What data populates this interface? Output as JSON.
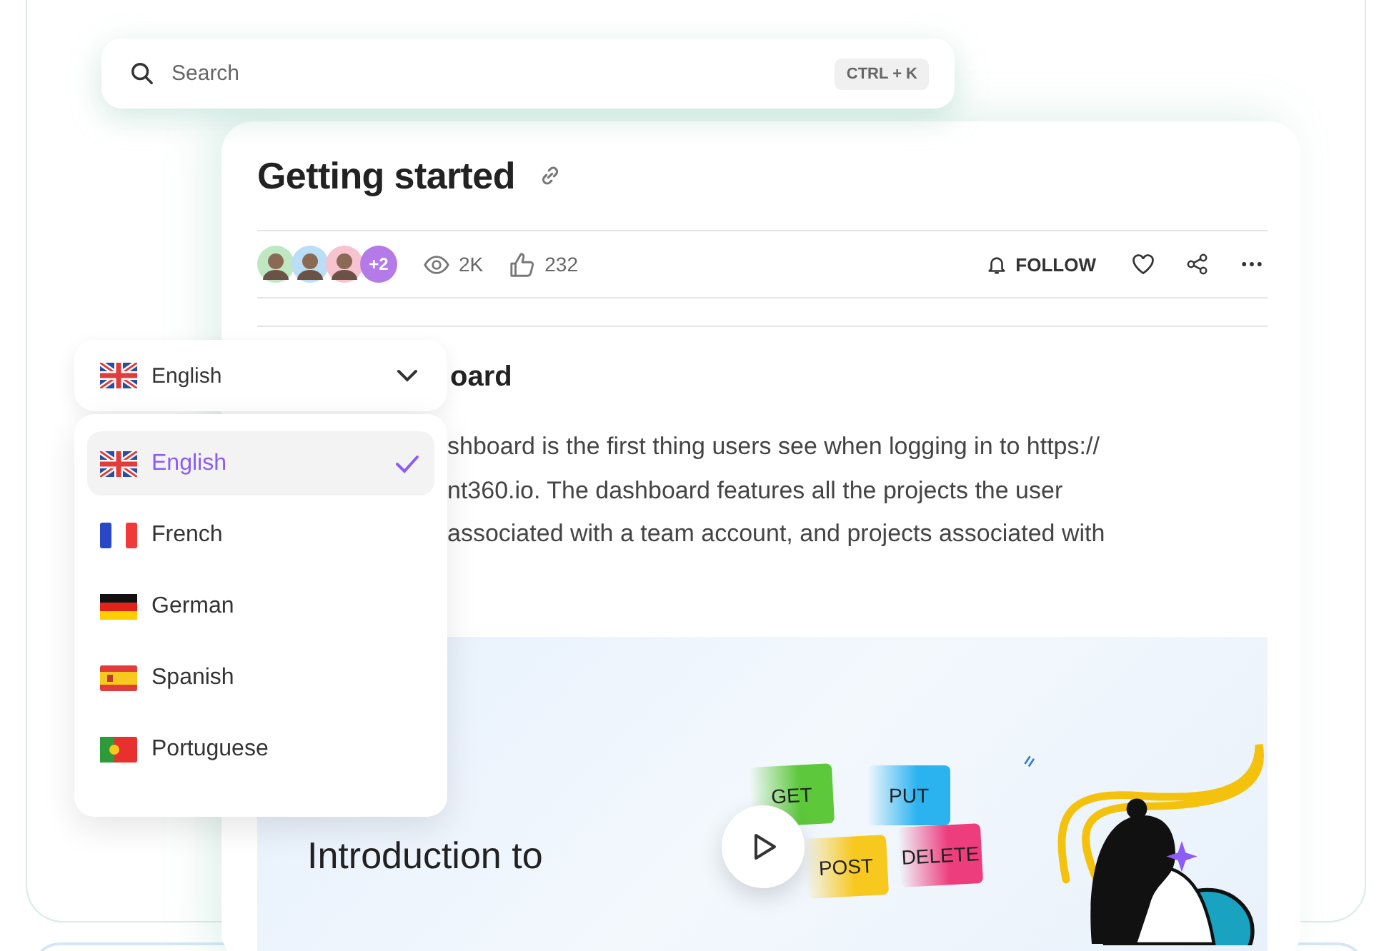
{
  "search": {
    "placeholder": "Search",
    "shortcut": "CTRL + K"
  },
  "article": {
    "title": "Getting started",
    "avatars": [
      {
        "color": "#bfe8c2"
      },
      {
        "color": "#b9def5"
      },
      {
        "color": "#f6c3cf"
      }
    ],
    "more_avatars": "+2",
    "views": "2K",
    "likes": "232",
    "follow_label": "FOLLOW",
    "section_heading": "oard",
    "paragraph_lines": [
      "shboard is the first thing users see when logging in to https://",
      "nt360.io. The dashboard features all the projects the user",
      "associated with a team account, and projects associated with"
    ]
  },
  "video": {
    "title": "Introduction to",
    "tags": [
      {
        "label": "GET",
        "color": "#5cc83a"
      },
      {
        "label": "PUT",
        "color": "#2bb3f0"
      },
      {
        "label": "POST",
        "color": "#f7c81e"
      },
      {
        "label": "DELETE",
        "color": "#ee3d7c"
      }
    ]
  },
  "language_select": {
    "current": {
      "label": "English",
      "kind": "uk"
    },
    "options": [
      {
        "label": "English",
        "kind": "uk",
        "selected": true
      },
      {
        "label": "French",
        "kind": "fr",
        "selected": false
      },
      {
        "label": "German",
        "kind": "de",
        "selected": false
      },
      {
        "label": "Spanish",
        "kind": "es",
        "selected": false
      },
      {
        "label": "Portuguese",
        "kind": "pt",
        "selected": false
      }
    ]
  }
}
